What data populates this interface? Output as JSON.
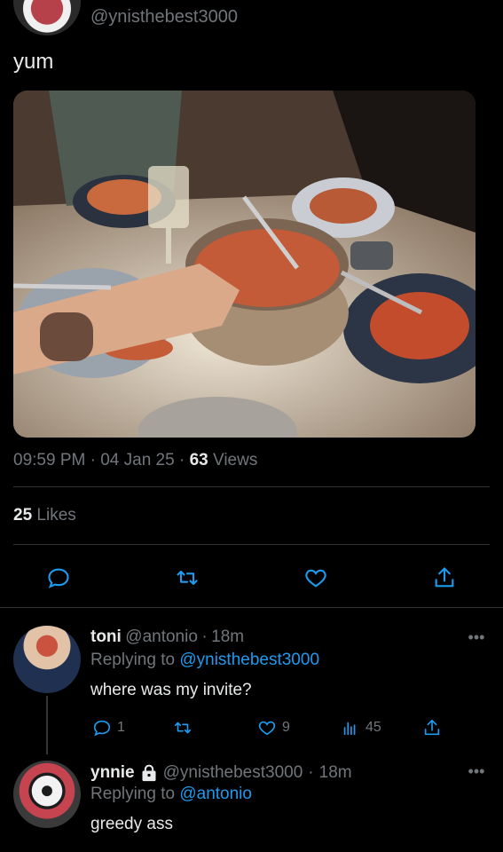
{
  "header": {
    "handle": "@ynisthebest3000"
  },
  "tweet": {
    "text": "yum",
    "time": "09:59 PM",
    "separator": "·",
    "date": "04 Jan 25",
    "views_count": "63",
    "views_label": "Views",
    "likes_count": "25",
    "likes_label": "Likes"
  },
  "actions": [
    "reply-icon",
    "retweet-icon",
    "like-icon",
    "share-icon"
  ],
  "replies": [
    {
      "name": "toni",
      "handle": "@antonio",
      "time": "18m",
      "replying_prefix": "Replying to",
      "replying_to": "@ynisthebest3000",
      "text": "where was my invite?",
      "reply_count": "1",
      "like_count": "9",
      "view_count": "45"
    },
    {
      "name": "ynnie",
      "handle": "@ynisthebest3000",
      "time": "18m",
      "replying_prefix": "Replying to",
      "replying_to": "@antonio",
      "text": "greedy ass"
    }
  ],
  "colors": {
    "background": "#000000",
    "text": "#e7e9ea",
    "muted": "#71767b",
    "link": "#1d9bf0",
    "divider": "#2f3336"
  }
}
